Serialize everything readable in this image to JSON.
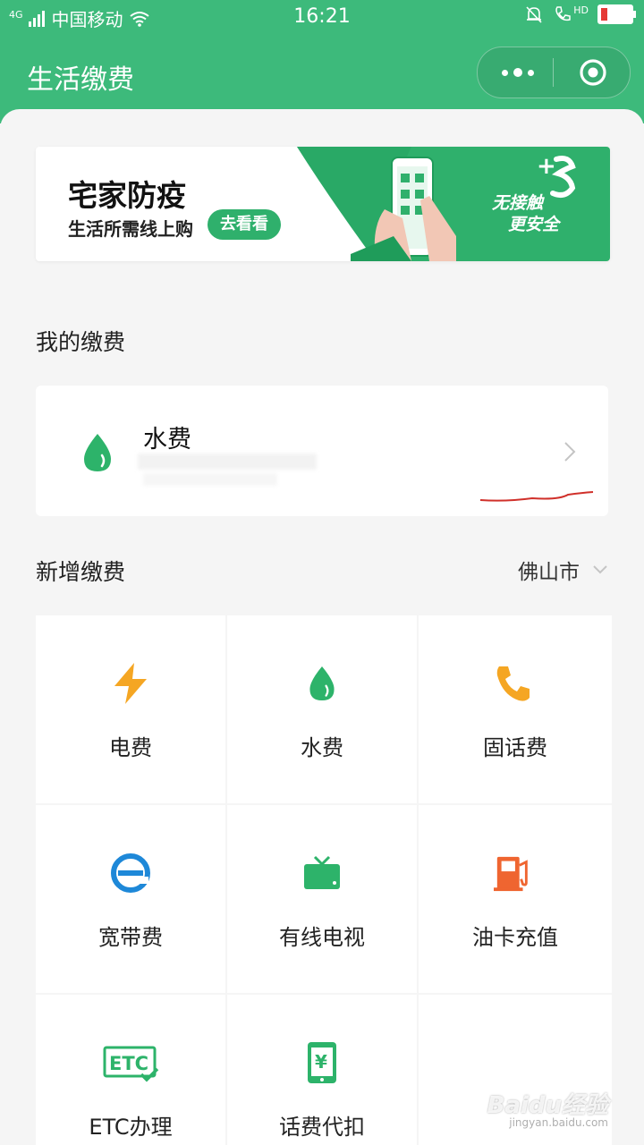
{
  "status_bar": {
    "network": "4G",
    "carrier": "中国移动",
    "time": "16:21",
    "hd_label": "HD"
  },
  "navbar": {
    "title": "生活缴费"
  },
  "banner": {
    "title": "宅家防疫",
    "subtitle": "生活所需线上购",
    "button": "去看看",
    "tag_line1": "无接触",
    "tag_line2": "更安全"
  },
  "my_payments": {
    "heading": "我的缴费",
    "items": [
      {
        "name": "水费",
        "icon": "water-drop-icon"
      }
    ]
  },
  "new_payment": {
    "heading": "新增缴费",
    "city": "佛山市",
    "services": [
      {
        "label": "电费",
        "icon": "lightning-icon",
        "color": "#f5a623"
      },
      {
        "label": "水费",
        "icon": "water-drop-icon",
        "color": "#2db36a"
      },
      {
        "label": "固话费",
        "icon": "phone-icon",
        "color": "#f5a623"
      },
      {
        "label": "宽带费",
        "icon": "broadband-e-icon",
        "color": "#1e88d8"
      },
      {
        "label": "有线电视",
        "icon": "tv-icon",
        "color": "#2db36a"
      },
      {
        "label": "油卡充值",
        "icon": "gas-pump-icon",
        "color": "#ef6530"
      },
      {
        "label": "ETC办理",
        "icon": "etc-icon",
        "color": "#2db36a"
      },
      {
        "label": "话费代扣",
        "icon": "mobile-yen-icon",
        "color": "#2db36a"
      }
    ]
  },
  "watermark": {
    "brand": "Baidu经验",
    "url": "jingyan.baidu.com"
  },
  "colors": {
    "brand_green": "#3dba7b",
    "banner_green": "#2fb06c"
  }
}
